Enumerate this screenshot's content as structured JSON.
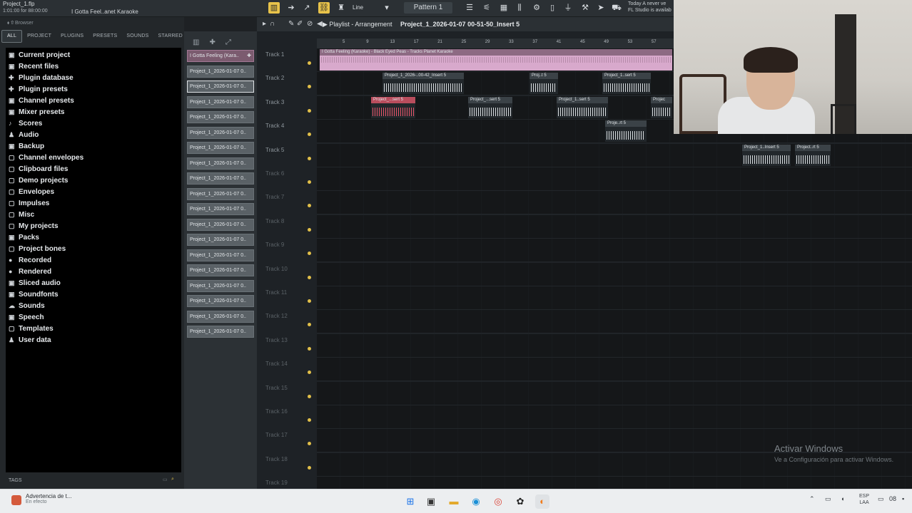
{
  "topbar": {
    "project_file": "Project_1.flp",
    "time": "1:01:00 for 88:00:00",
    "song": "I Gotta Feel..anet Karaoke",
    "snap": "Line",
    "pattern": "Pattern 1",
    "news_line1": "Today  A never ve",
    "news_line2": "FL Studio is availab"
  },
  "browser": {
    "header": "Browser",
    "tabs": [
      "ALL",
      "PROJECT",
      "PLUGINS",
      "PRESETS",
      "SOUNDS",
      "STARRED"
    ],
    "items": [
      {
        "icon": "▣",
        "label": "Current project"
      },
      {
        "icon": "▣",
        "label": "Recent files"
      },
      {
        "icon": "✚",
        "label": "Plugin database"
      },
      {
        "icon": "✚",
        "label": "Plugin presets"
      },
      {
        "icon": "▣",
        "label": "Channel presets"
      },
      {
        "icon": "▣",
        "label": "Mixer presets"
      },
      {
        "icon": "♪",
        "label": "Scores"
      },
      {
        "icon": "♟",
        "label": "Audio"
      },
      {
        "icon": "▣",
        "label": "Backup"
      },
      {
        "icon": "▢",
        "label": "Channel envelopes"
      },
      {
        "icon": "▢",
        "label": "Clipboard files"
      },
      {
        "icon": "▢",
        "label": "Demo projects"
      },
      {
        "icon": "▢",
        "label": "Envelopes"
      },
      {
        "icon": "▢",
        "label": "Impulses"
      },
      {
        "icon": "▢",
        "label": "Misc"
      },
      {
        "icon": "▢",
        "label": "My projects"
      },
      {
        "icon": "▣",
        "label": "Packs"
      },
      {
        "icon": "▢",
        "label": "Project bones"
      },
      {
        "icon": "●",
        "label": "Recorded"
      },
      {
        "icon": "●",
        "label": "Rendered"
      },
      {
        "icon": "▣",
        "label": "Sliced audio"
      },
      {
        "icon": "▣",
        "label": "Soundfonts"
      },
      {
        "icon": "☁",
        "label": "Sounds"
      },
      {
        "icon": "▣",
        "label": "Speech"
      },
      {
        "icon": "▢",
        "label": "Templates"
      },
      {
        "icon": "♟",
        "label": "User data"
      }
    ],
    "footer": "TAGS"
  },
  "picker": {
    "clips": [
      "I Gotta Feeling (Kara..",
      "Project_1_2026-01-07 0..",
      "Project_1_2026-01-07 0..",
      "Project_1_2026-01-07 0..",
      "Project_1_2026-01-07 0..",
      "Project_1_2026-01-07 0..",
      "Project_1_2026-01-07 0..",
      "Project_1_2026-01-07 0..",
      "Project_1_2026-01-07 0..",
      "Project_1_2026-01-07 0..",
      "Project_1_2026-01-07 0..",
      "Project_1_2026-01-07 0..",
      "Project_1_2026-01-07 0..",
      "Project_1_2026-01-07 0..",
      "Project_1_2026-01-07 0..",
      "Project_1_2026-01-07 0..",
      "Project_1_2026-01-07 0..",
      "Project_1_2026-01-07 0..",
      "Project_1_2026-01-07 0.."
    ]
  },
  "playlist": {
    "title": "Playlist - Arrangement",
    "breadcrumb": "Project_1_2026-01-07 00-51-50_Insert 5",
    "ruler": [
      "5",
      "9",
      "13",
      "17",
      "21",
      "25",
      "29",
      "33",
      "37",
      "41",
      "45",
      "49",
      "53",
      "57"
    ],
    "tracks": [
      "Track 1",
      "Track 2",
      "Track 3",
      "Track 4",
      "Track 5",
      "Track 6",
      "Track 7",
      "Track 8",
      "Track 9",
      "Track 10",
      "Track 11",
      "Track 12",
      "Track 13",
      "Track 14",
      "Track 15",
      "Track 16",
      "Track 17",
      "Track 18",
      "Track 19"
    ],
    "clip_labels": {
      "t1": "I Gotta Feeling (Karaoke) - Black Eyed Peas - Tracks Planet Karaoke",
      "t2a": "Project_1_2026-..00-42_Insert 5",
      "t2b": "Proj..t 5",
      "t2c": "Project_1..sert 5",
      "t3a": "Project_...sert 5",
      "t3b": "Project_...sert 5",
      "t3c": "Project_1..sert 5",
      "t3d": "Projec",
      "t4": "Proje..rt 5",
      "t5a": "Project_1..Insert 5",
      "t5b": "Project..rt 5"
    }
  },
  "overlay": {
    "activate_title": "Activar Windows",
    "activate_sub": "Ve a Configuración para activar Windows."
  },
  "taskbar": {
    "notif_title": "Advertencia de t...",
    "notif_sub": "En efecto",
    "lang": "ESP",
    "lang2": "LAA",
    "time": "08"
  }
}
